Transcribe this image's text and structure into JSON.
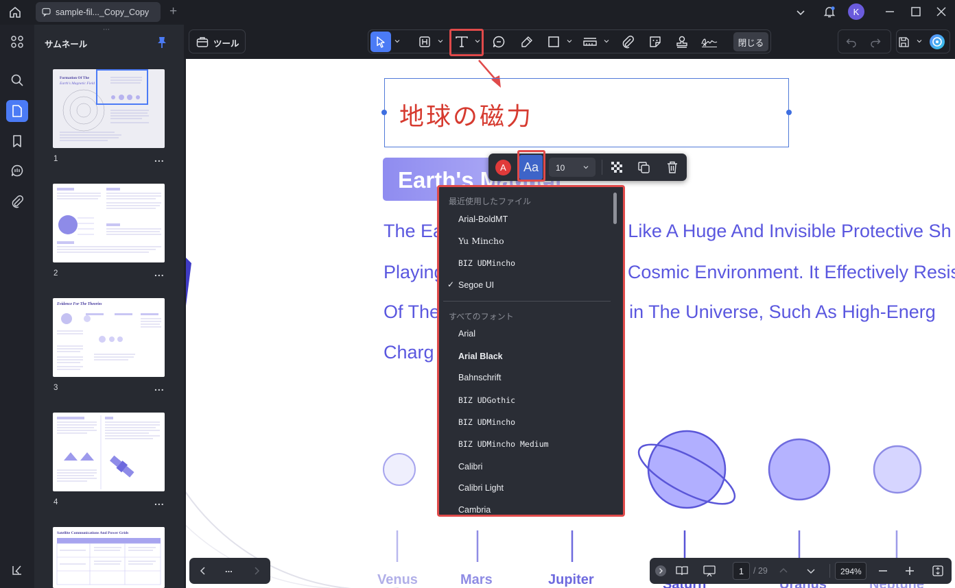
{
  "titlebar": {
    "tab_title": "sample-fil..._Copy_Copy",
    "new_tab": "+",
    "avatar_letter": "K"
  },
  "sidebar": {
    "title": "サムネール",
    "thumbnails": [
      {
        "number": "1",
        "heading": "Formation Of The",
        "subheading": "Earth's Magnetic Field"
      },
      {
        "number": "2"
      },
      {
        "number": "3",
        "heading": "Evidence For The Theories"
      },
      {
        "number": "4"
      },
      {
        "number": "",
        "heading": "Satellite Communications And Power Grids"
      }
    ],
    "thumb_menu": "..."
  },
  "toolbar": {
    "tools_label": "ツール",
    "close_label": "閉じる"
  },
  "document": {
    "annotation_text": "地球の磁力",
    "heading": "Earth's Magnetic",
    "paragraph_lines": [
      "The Earth's Magnetic Field Is Like A Huge And Invisible Protective Sh",
      "Playing A Role In The Earth's Cosmic Environment. It Effectively Resists",
      "Of The Harmful Cosmic Rays in The Universe, Such As High-Energ",
      "Charg"
    ],
    "planets": [
      "Venus",
      "Mars",
      "Jupiter",
      "Saturn",
      "Uranus",
      "Neptune"
    ]
  },
  "minibar": {
    "color_letter": "A",
    "font_button": "Aa",
    "font_size": "10"
  },
  "font_menu": {
    "recent_header": "最近使用したファイル",
    "recent": [
      "Arial-BoldMT",
      "Yu Mincho",
      "BIZ UDMincho",
      "Segoe UI"
    ],
    "selected": "Segoe UI",
    "check_mark": "✓",
    "all_header": "すべてのフォント",
    "all": [
      "Arial",
      "Arial Black",
      "Bahnschrift",
      "BIZ UDGothic",
      "BIZ UDMincho",
      "BIZ UDMincho Medium",
      "Calibri",
      "Calibri Light",
      "Cambria"
    ]
  },
  "statusbar": {
    "page_current": "1",
    "page_total": "/ 29",
    "zoom": "294%"
  },
  "navbar": {
    "more": "..."
  },
  "colors": {
    "accent": "#4b7bf5",
    "highlight_red": "#e04a4a",
    "doc_text": "#5a57df",
    "annotation_red": "#d63a2f"
  }
}
